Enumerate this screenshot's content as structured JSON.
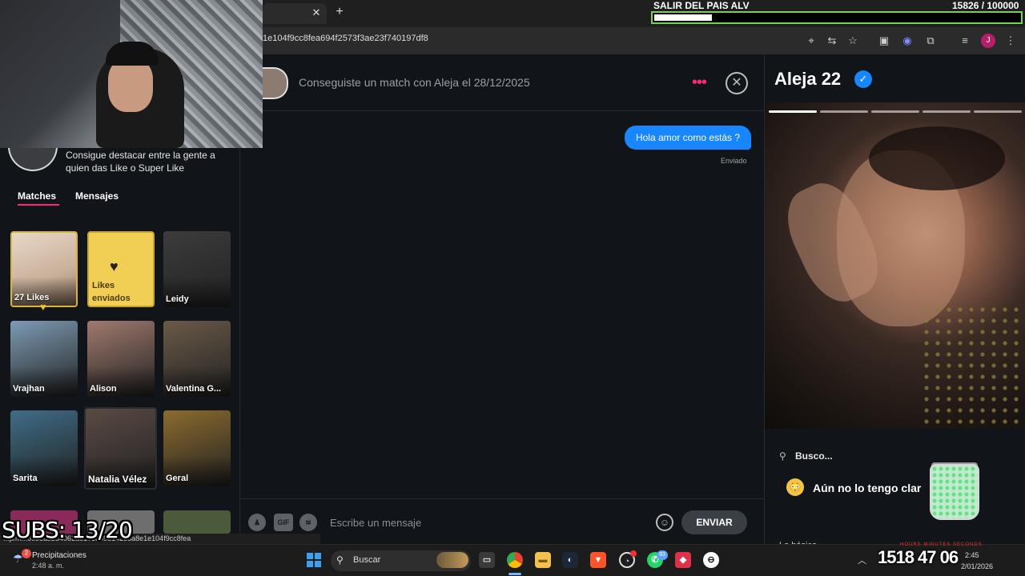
{
  "browser": {
    "tab_close": "✕",
    "new_tab": "+",
    "url": "1e104f9cc8fea694f2573f3ae23f740197df8",
    "profile_initial": "J"
  },
  "goal_overlay": {
    "label": "SALIR DEL PAIS ALV",
    "count": "15826  / 100000",
    "progress_fraction": 0.158,
    "bar_color": "#7ccf55"
  },
  "sidebar": {
    "promo_text": "Consigue destacar entre la gente a quien das Like o Super Like",
    "tabs": [
      {
        "label": "Matches",
        "active": true
      },
      {
        "label": "Mensajes",
        "active": false
      }
    ],
    "accent_color": "#fd267a",
    "cards": [
      {
        "label": "27 Likes",
        "kind": "likes"
      },
      {
        "label": "Likes enviados",
        "kind": "likes-sent"
      },
      {
        "label": "Leidy",
        "tone": "#3c3c3c"
      },
      {
        "label": "Vrajhan",
        "tone": "#7d9bb4"
      },
      {
        "label": "Alison",
        "tone": "#a07a6e"
      },
      {
        "label": "Valentina G...",
        "tone": "#6a5a48"
      },
      {
        "label": "Sarita",
        "tone": "#3f6d87"
      },
      {
        "label": "Natalia Vélez",
        "tone": "#5a4a44"
      },
      {
        "label": "Geral",
        "tone": "#8c6b2e"
      }
    ]
  },
  "chat": {
    "match_text": "Conseguiste un match con Aleja el 28/12/2025",
    "more_icon": "•••",
    "close_icon": "✕",
    "messages": [
      {
        "text": "Hola amor como estás ?",
        "status": "Enviado",
        "color": "#1786ff"
      }
    ],
    "composer": {
      "placeholder": "Escribe un mensaje",
      "gif_label": "GIF",
      "send_label": "ENVIAR"
    }
  },
  "profile": {
    "name": "Aleja 22",
    "verified_icon": "✓",
    "photo_count": 5,
    "busco_label": "Busco...",
    "busco_value": "Aún no lo tengo clar",
    "busco_emoji": "😳",
    "basico_label": "Lo básico"
  },
  "overlay": {
    "subs_text": "SUBS: 13/20",
    "status_url": "...p/m...60beab284062a6173a69314238a8e1e104f9cc8fea",
    "timer": "1518  47  06",
    "timer_labels": "HOURS  MINUTES  SECONDS"
  },
  "taskbar": {
    "weather_title": "Precipitaciones",
    "weather_time": "2:48 a. m.",
    "weather_badge": "2",
    "search_label": "Buscar",
    "whatsapp_badge": "83",
    "tray_time": "2:45",
    "tray_date": "2/01/2026"
  }
}
